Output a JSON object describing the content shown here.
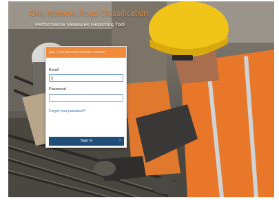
{
  "app": {
    "title": "One Network Road Classification",
    "subtitle": "Performance Measures Reporting Tool"
  },
  "login": {
    "brand_text": "RCL | THE ROAD EFFICIENCY GROUP",
    "email_label": "Email",
    "email_value": "",
    "password_label": "Password",
    "password_value": "",
    "forgot_link": "Forgot your password?",
    "signin_label": "Sign In",
    "signin_icon": "chevron-right-icon"
  },
  "colors": {
    "accent": "#f18a3b",
    "button": "#1f4e79",
    "link": "#3a6fb0"
  }
}
